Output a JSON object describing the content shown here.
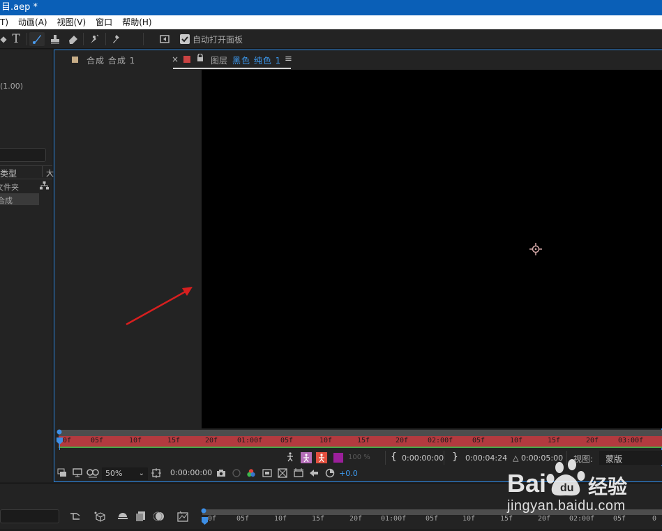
{
  "window": {
    "title": "目.aep *"
  },
  "menu": [
    "T)",
    "动画(A)",
    "视图(V)",
    "窗口",
    "帮助(H)"
  ],
  "toolbar": {
    "auto_open_label": "自动打开面板",
    "auto_open_checked": true
  },
  "left_panel": {
    "value": "(1.00)",
    "column_header": "类型",
    "rows": [
      "文件夹",
      "合成"
    ]
  },
  "tabs": {
    "comp_tab": "合成 合成 1",
    "layer_tab_prefix": "图层",
    "layer_tab_name": "黑色 纯色 1",
    "close": "×",
    "menu": "≡"
  },
  "ruler_ticks": [
    "0f",
    "05f",
    "10f",
    "15f",
    "20f",
    "01:00f",
    "05f",
    "10f",
    "15f",
    "20f",
    "02:00f",
    "05f",
    "10f",
    "15f",
    "20f",
    "03:00f"
  ],
  "layer_controls": {
    "opacity": "100 %",
    "in_point": "0:00:00:00",
    "out_point": "0:00:04:24",
    "duration": "△ 0:00:05:00",
    "view_label": "视图:",
    "view_value": "蒙版"
  },
  "viewer_toolbar": {
    "zoom": "50%",
    "timecode": "0:00:00:00",
    "exposure": "+0.0"
  },
  "bottom_timeline_ticks": [
    "0f",
    "05f",
    "10f",
    "15f",
    "20f",
    "01:00f",
    "05f",
    "10f",
    "15f",
    "20f",
    "02:00f",
    "05f",
    "0"
  ],
  "watermark": {
    "brand": "Bai",
    "brand_tail": "经验",
    "url": "jingyan.baidu.com"
  },
  "colors": {
    "accent": "#2d8ceb",
    "ruler": "#b33a3f",
    "arrow": "#d71f1f",
    "title_bar": "#0a5fb7"
  }
}
